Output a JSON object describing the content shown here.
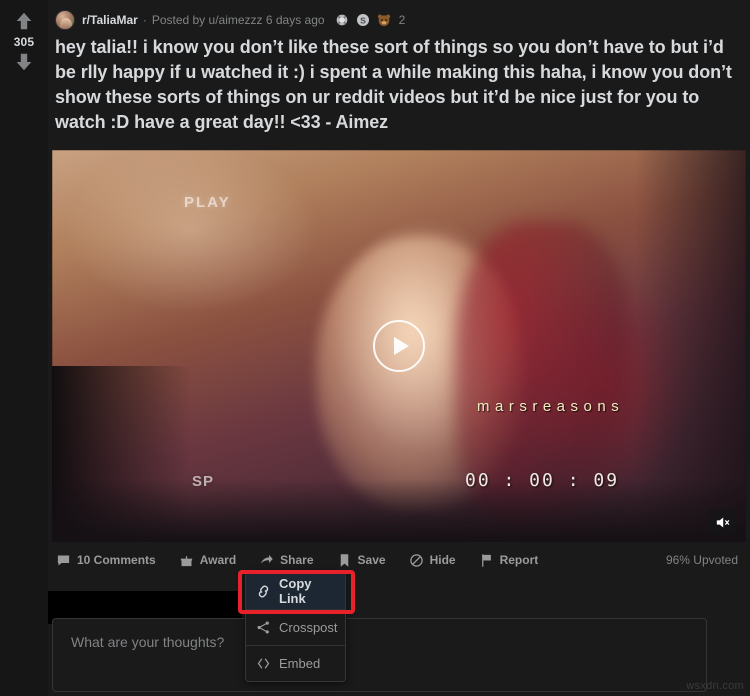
{
  "vote": {
    "upvote_icon": "arrow-up-icon",
    "downvote_icon": "arrow-down-icon",
    "score": "305"
  },
  "post": {
    "subreddit": "r/TaliaMar",
    "separator": "·",
    "posted_by": "Posted by u/aimezzz 6 days ago",
    "awards": [
      {
        "icon": "silver-award-icon",
        "name": "award-badge-1"
      },
      {
        "icon": "s-award-icon",
        "name": "award-badge-2"
      },
      {
        "icon": "wholesome-award-icon",
        "name": "award-badge-3"
      }
    ],
    "award_count": "2",
    "title": "hey talia!! i know you don’t like these sort of things so you don’t have to but i’d be rlly happy if u watched it :) i spent a while making this haha, i know you don’t show these sorts of things on ur reddit videos but it’d be nice just for you to watch :D have a great day!! <33 - Aimez"
  },
  "video": {
    "play_overlay_text": "PLAY",
    "sp_label": "SP",
    "creator_watermark": "marsreasons",
    "timecode": "00 : 00 : 09",
    "play_button_icon": "play-icon",
    "mute_icon": "speaker-mute-icon"
  },
  "actions": [
    {
      "icon": "comment-bubble-icon",
      "label": "10 Comments"
    },
    {
      "icon": "gift-icon",
      "label": "Award"
    },
    {
      "icon": "share-arrow-icon",
      "label": "Share"
    },
    {
      "icon": "bookmark-icon",
      "label": "Save"
    },
    {
      "icon": "hide-slash-icon",
      "label": "Hide"
    },
    {
      "icon": "flag-icon",
      "label": "Report"
    }
  ],
  "upvoted_percent": "96% Upvoted",
  "share_menu": {
    "items": [
      {
        "icon": "link-chain-icon",
        "label": "Copy Link",
        "highlighted": true
      },
      {
        "icon": "crosspost-icon",
        "label": "Crosspost",
        "highlighted": false
      },
      {
        "icon": "embed-code-icon",
        "label": "Embed",
        "highlighted": false
      }
    ],
    "highlight_color": "#e8222b"
  },
  "comment_composer": {
    "placeholder": "What are your thoughts?"
  },
  "watermark": "wsxdn.com"
}
